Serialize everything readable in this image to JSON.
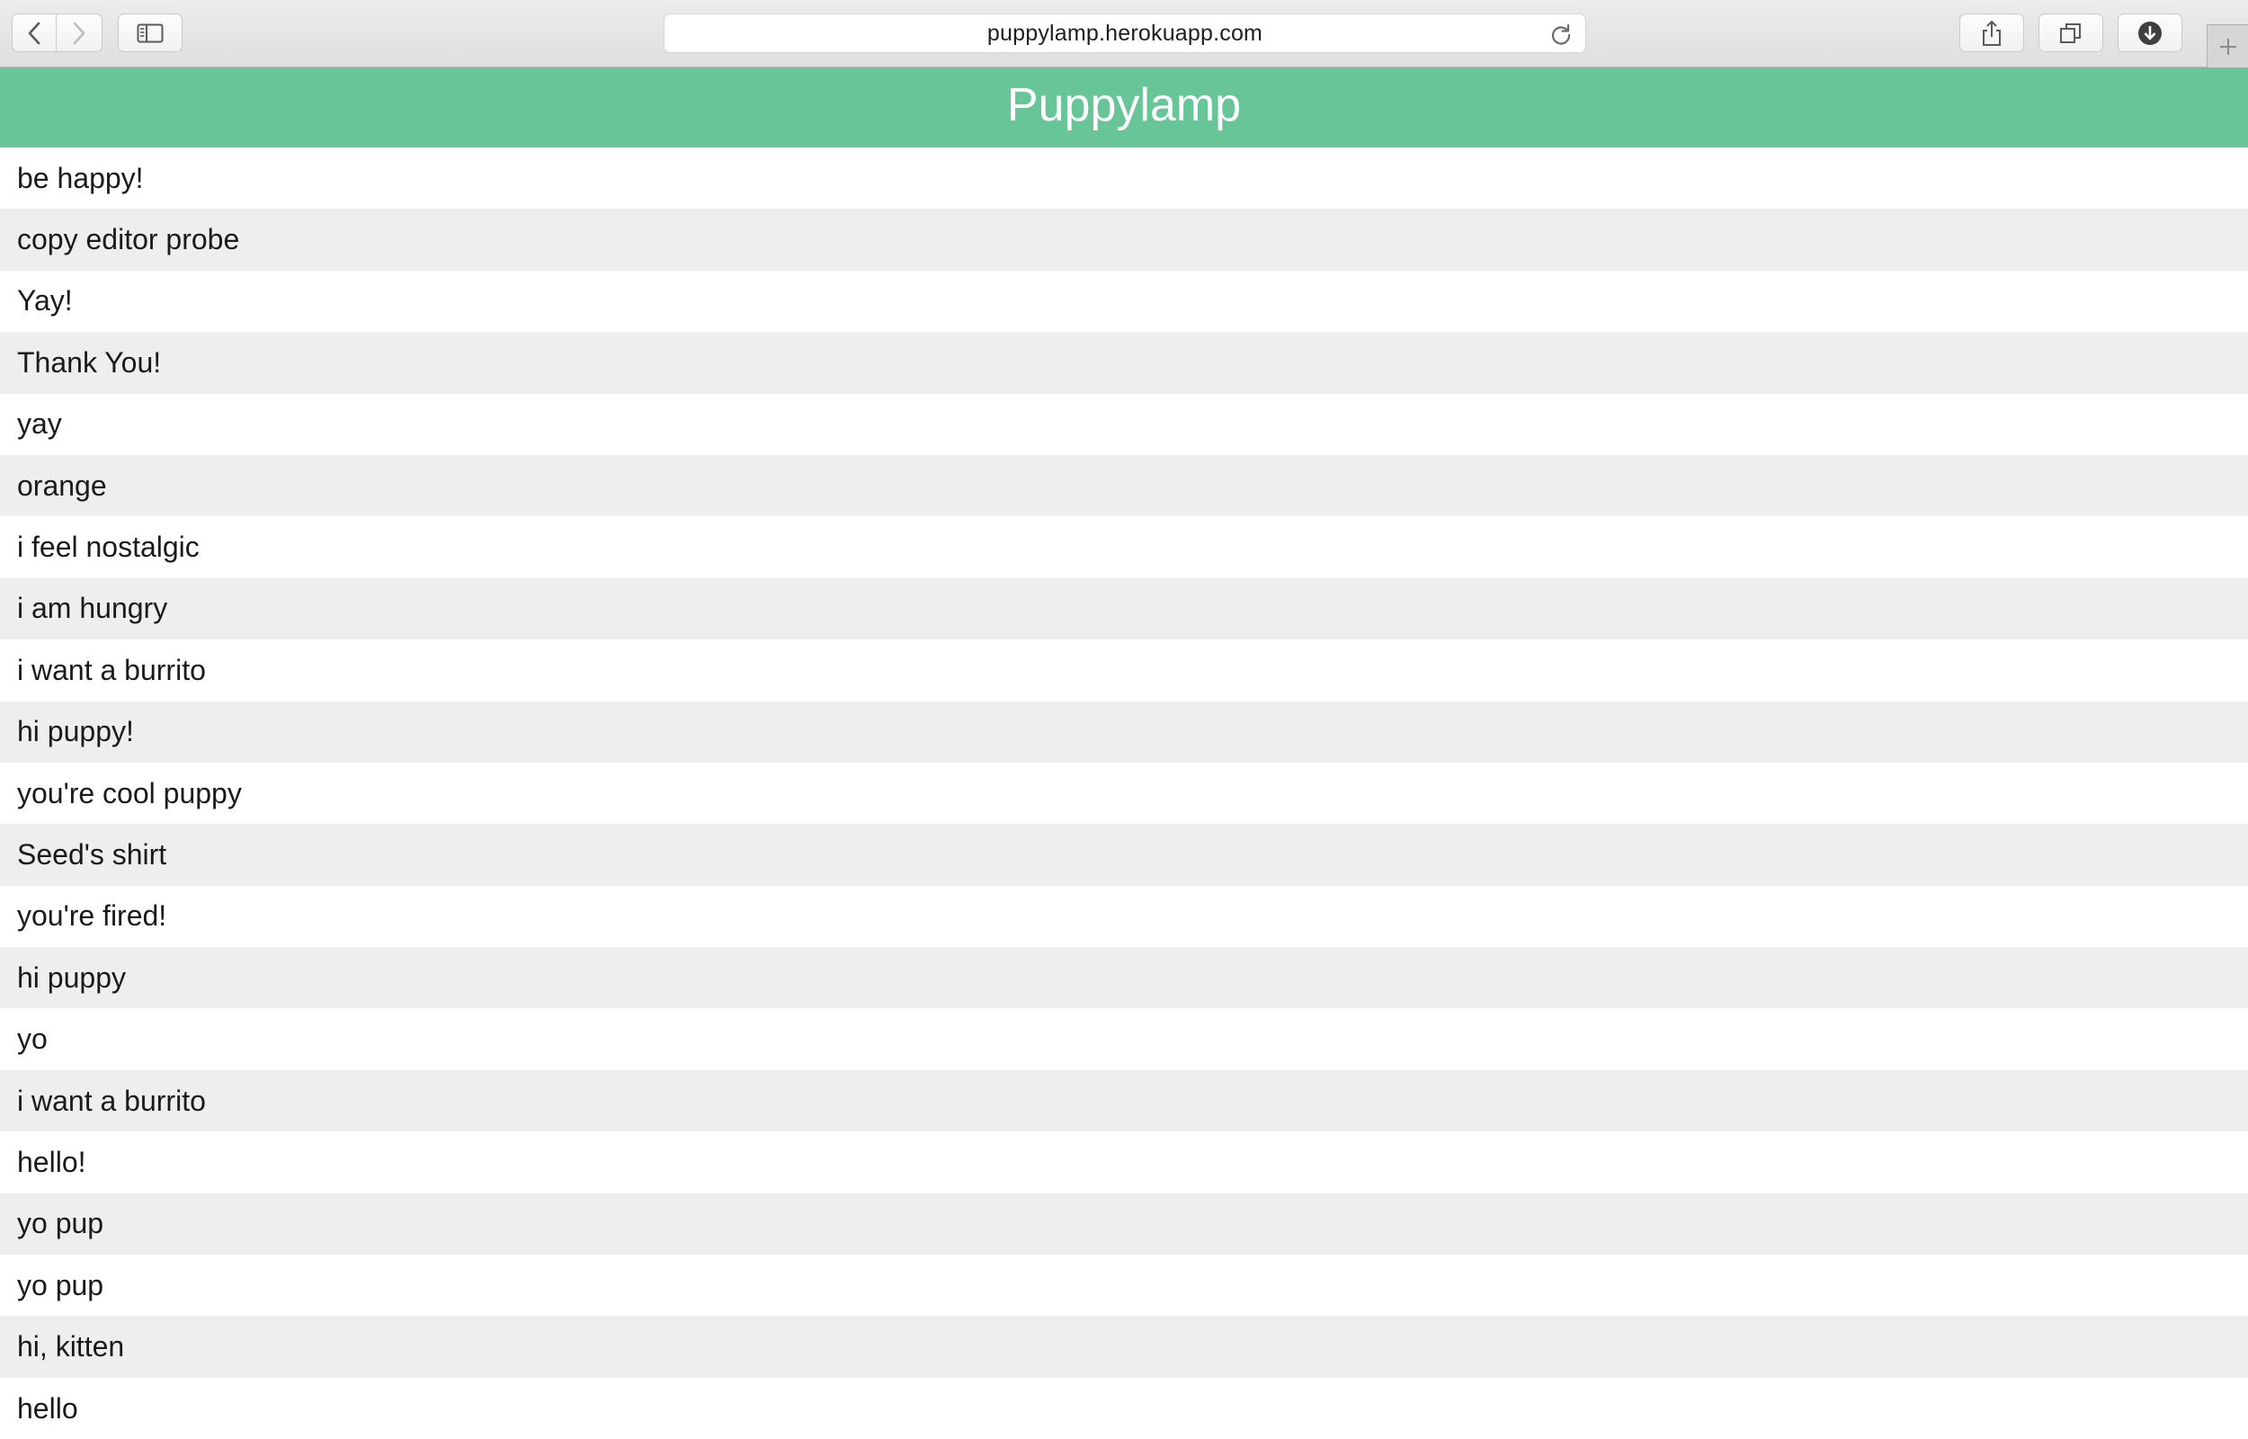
{
  "browser": {
    "url": "puppylamp.herokuapp.com"
  },
  "page": {
    "title": "Puppylamp",
    "accent_color": "#67c598",
    "messages": [
      "be happy!",
      "copy editor probe",
      "Yay!",
      "Thank You!",
      "yay",
      "orange",
      "i feel nostalgic",
      "i am hungry",
      "i want a burrito",
      "hi puppy!",
      "you're cool puppy",
      "Seed's shirt",
      "you're fired!",
      "hi puppy",
      "yo",
      "i want a burrito",
      "hello!",
      "yo pup",
      "yo pup",
      "hi, kitten",
      "hello"
    ]
  }
}
